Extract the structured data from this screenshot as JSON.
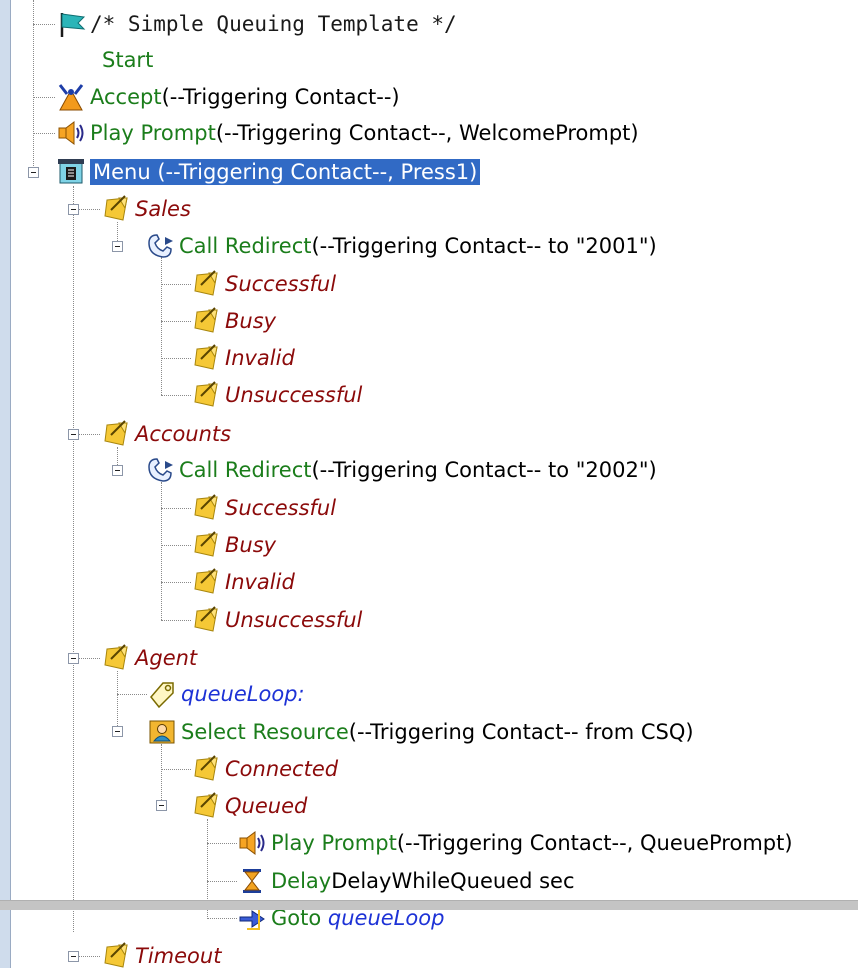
{
  "tree": {
    "comment": "/* Simple Queuing Template */",
    "start": "Start",
    "accept": {
      "label": "Accept",
      "args": " (--Triggering Contact--)"
    },
    "play_prompt": {
      "label": "Play Prompt",
      "args": " (--Triggering Contact--, WelcomePrompt)"
    },
    "menu": {
      "text": "Menu (--Triggering Contact--, Press1)"
    },
    "sales": {
      "label": "Sales",
      "redirect": {
        "label": "Call Redirect",
        "args": " (--Triggering Contact-- to \"2001\")"
      },
      "branches": [
        "Successful",
        "Busy",
        "Invalid",
        "Unsuccessful"
      ]
    },
    "accounts": {
      "label": "Accounts",
      "redirect": {
        "label": "Call Redirect",
        "args": " (--Triggering Contact-- to \"2002\")"
      },
      "branches": [
        "Successful",
        "Busy",
        "Invalid",
        "Unsuccessful"
      ]
    },
    "agent": {
      "label": "Agent",
      "queue_label": "queueLoop:",
      "select_resource": {
        "label": "Select Resource",
        "args": " (--Triggering Contact-- from CSQ)"
      },
      "connected": "Connected",
      "queued": "Queued",
      "queue_prompt": {
        "label": "Play Prompt",
        "args": " (--Triggering Contact--, QueuePrompt)"
      },
      "delay": {
        "label": "Delay",
        "args": " DelayWhileQueued sec"
      },
      "goto": {
        "label": "Goto",
        "target": "queueLoop"
      }
    },
    "timeout": "Timeout"
  },
  "icons": {
    "start": "flag-icon",
    "accept": "accept-icon",
    "play_prompt": "speaker-icon",
    "menu": "menu-icon",
    "branch": "branch-tag-icon",
    "call_redirect": "call-redirect-icon",
    "label": "label-tag-icon",
    "select_resource": "agent-resource-icon",
    "delay": "hourglass-icon",
    "goto": "goto-icon"
  },
  "colors": {
    "step": "#1b7d1b",
    "branch": "#8b0a0a",
    "label": "#1d32d6",
    "selection": "#316ac5"
  }
}
